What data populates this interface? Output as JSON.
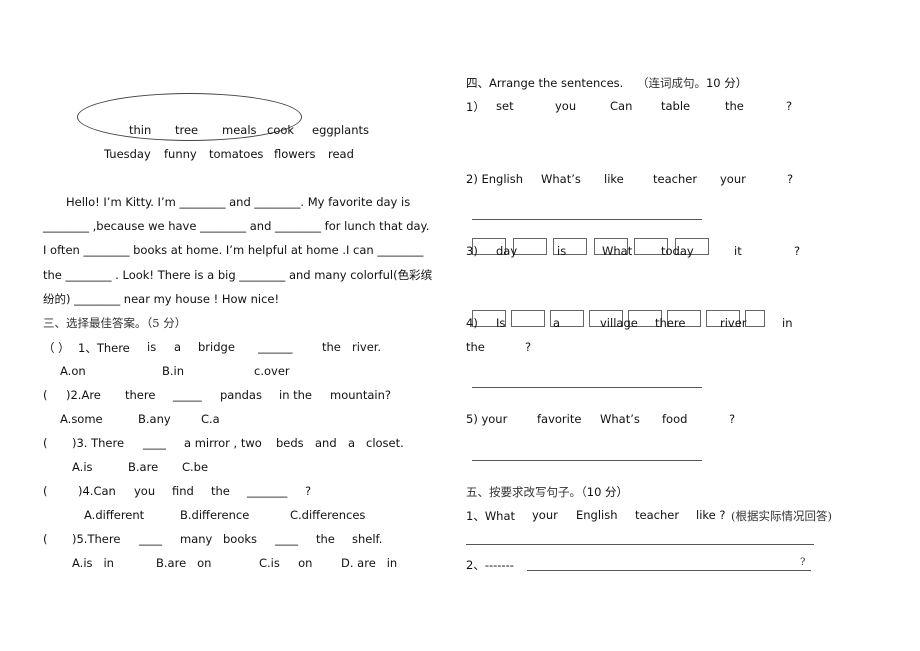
{
  "word_bank": {
    "row1": [
      "thin",
      "tree",
      "meals",
      "cook",
      "eggplants"
    ],
    "row2": [
      "Tuesday",
      "funny",
      "tomatoes",
      "flowers",
      "read"
    ]
  },
  "passage": {
    "lines": [
      "Hello! I’m Kitty. I’m ________ and ________. My favorite day is",
      "________ ,because we have ________ and ________ for lunch that day.",
      "I often ________ books at home. I’m helpful at home .I can ________",
      "the ________ . Look! There is a big ________ and many colorful(色彩缤",
      "纷的) ________ near my house ! How nice!"
    ]
  },
  "section3": {
    "title": "三、选择最佳答案。（5 分）",
    "questions": [
      {
        "paren": "（  ）",
        "words": [
          "1、There",
          "is",
          "a",
          "bridge",
          "______",
          "the",
          "river."
        ],
        "options": [
          "A.on",
          "B.in",
          "c.over"
        ]
      },
      {
        "paren": "(",
        "words": [
          ")2.Are",
          "there",
          "_____",
          "pandas",
          "in the",
          "mountain?"
        ],
        "options": [
          "A.some",
          "B.any",
          "C.a"
        ]
      },
      {
        "paren": "(",
        "words": [
          ")3. There",
          "____",
          "a mirror , two",
          "beds",
          "and",
          "a",
          "closet."
        ],
        "options": [
          "A.is",
          "B.are",
          "C.be"
        ]
      },
      {
        "paren": "(",
        "words": [
          ")4.Can",
          "you",
          "find",
          "the",
          "_______",
          "?"
        ],
        "options": [
          "A.different",
          "B.difference",
          "C.differences"
        ]
      },
      {
        "paren": "(",
        "words": [
          ")5.There",
          "____",
          "many",
          "books",
          "____",
          "the",
          "shelf."
        ],
        "options": [
          "A.is   in",
          "B.are   on",
          "C.is     on",
          "D. are   in"
        ]
      }
    ]
  },
  "section4": {
    "title": "四、Arrange the sentences.",
    "title_cn": "（连词成句。",
    "title_score": "10 分）",
    "items": [
      {
        "num": "1）",
        "words": [
          "set",
          "you",
          "Can",
          "table",
          "the",
          "?"
        ]
      },
      {
        "num": "2) English",
        "words": [
          "What’s",
          "like",
          "teacher",
          "your",
          "?"
        ]
      },
      {
        "num": "3)",
        "words": [
          "day",
          "is",
          "What",
          "today",
          "it",
          "?"
        ]
      },
      {
        "num": "4)",
        "words": [
          "Is",
          "a",
          "village",
          "there",
          "river",
          "in"
        ],
        "wrap": [
          "the",
          "?"
        ]
      },
      {
        "num": "5) your",
        "words": [
          "favorite",
          "What’s",
          "food",
          "?"
        ]
      }
    ]
  },
  "section5": {
    "title": "五、按要求改写句子。（",
    "title_score": "10 分）",
    "q1": {
      "words": [
        "1、What",
        "your",
        "English",
        "teacher",
        "like ?"
      ],
      "note": "(根据实际情况回答)"
    },
    "q2": {
      "prefix": "2、-------",
      "end": "?"
    }
  }
}
